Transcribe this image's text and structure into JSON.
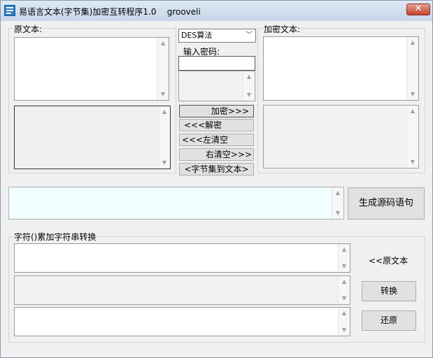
{
  "window": {
    "title": "易语言文本(字节集)加密互转程序1.0    grooveli",
    "close_label": "✕"
  },
  "left_panel": {
    "label": "原文本:"
  },
  "middle_panel": {
    "algorithm_selected": "DES算法",
    "password_label": "输入密码:",
    "password_value": "",
    "buttons": {
      "encrypt": "加密>>>",
      "decrypt": "<<<解密",
      "clear_left": "<<<左清空",
      "clear_right": "右清空>>>",
      "bytes_to_text": "<字节集到文本>"
    }
  },
  "right_panel": {
    "label": "加密文本:"
  },
  "source_code": {
    "value": "",
    "generate_button": "生成源码语句"
  },
  "char_panel": {
    "label": "字符()累加字符串转换",
    "original_text_label": "<<原文本",
    "convert_button": "转换",
    "restore_button": "还原"
  },
  "colors": {
    "source_code_background": "#f0ffff",
    "close_button": "#c4432e"
  }
}
